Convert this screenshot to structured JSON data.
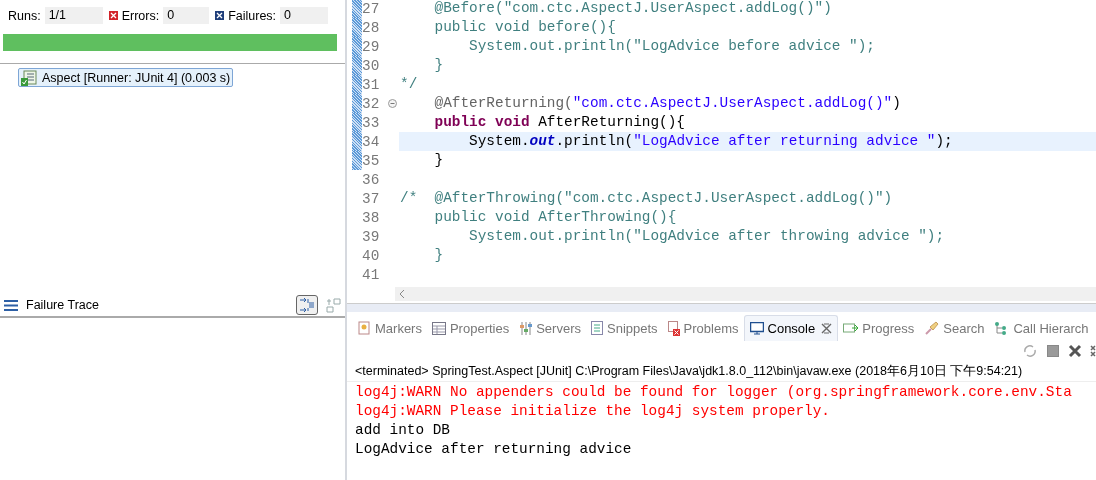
{
  "junit": {
    "counters": [
      {
        "kind": "runs",
        "label": "Runs:",
        "value": "1/1"
      },
      {
        "kind": "errors",
        "label": "Errors:",
        "value": "0"
      },
      {
        "kind": "failures",
        "label": "Failures:",
        "value": "0"
      }
    ],
    "progress": {
      "level": 1
    },
    "tree": [
      {
        "label": "Aspect [Runner: JUnit 4] (0.003 s)",
        "selected": true
      }
    ],
    "failure_trace": {
      "title": "Failure Trace",
      "toggle_pressed": true
    }
  },
  "editor": {
    "lines": [
      {
        "number": "27",
        "changed": true,
        "current": false,
        "segments": [
          {
            "kind": "comment",
            "text": "    @Before(\"com.ctc.AspectJ.UserAspect.addLog()\")"
          }
        ]
      },
      {
        "number": "28",
        "changed": true,
        "current": false,
        "segments": [
          {
            "kind": "comment",
            "text": "    public void before(){"
          }
        ]
      },
      {
        "number": "29",
        "changed": true,
        "current": false,
        "segments": [
          {
            "kind": "comment",
            "text": "        System.out.println(\"LogAdvice before advice \");"
          }
        ]
      },
      {
        "number": "30",
        "changed": true,
        "current": false,
        "segments": [
          {
            "kind": "comment",
            "text": "    }"
          }
        ]
      },
      {
        "number": "31",
        "changed": true,
        "current": false,
        "segments": [
          {
            "kind": "comment",
            "text": "*/"
          }
        ]
      },
      {
        "number": "32",
        "changed": true,
        "current": false,
        "fold_marker": true,
        "segments": [
          {
            "kind": "annotation",
            "text": "    @AfterReturning("
          },
          {
            "kind": "string",
            "text": "\"com.ctc.AspectJ.UserAspect.addLog()\""
          },
          {
            "kind": "plain",
            "text": ")"
          }
        ]
      },
      {
        "number": "33",
        "changed": true,
        "current": false,
        "segments": [
          {
            "kind": "keyword",
            "text": "    public"
          },
          {
            "kind": "keyword",
            "text": " void"
          },
          {
            "kind": "plain",
            "text": " AfterReturning(){"
          }
        ]
      },
      {
        "number": "34",
        "changed": true,
        "current": true,
        "segments": [
          {
            "kind": "plain",
            "text": "        System."
          },
          {
            "kind": "field",
            "text": "out"
          },
          {
            "kind": "plain",
            "text": ".println("
          },
          {
            "kind": "string",
            "text": "\"LogAdvice after returning advice \""
          },
          {
            "kind": "plain",
            "text": ");"
          }
        ]
      },
      {
        "number": "35",
        "changed": true,
        "current": false,
        "segments": [
          {
            "kind": "plain",
            "text": "    }"
          }
        ]
      },
      {
        "number": "36",
        "changed": false,
        "current": false
      },
      {
        "number": "37",
        "changed": false,
        "current": false,
        "segments": [
          {
            "kind": "comment",
            "text": "/*  @AfterThrowing(\"com.ctc.AspectJ.UserAspect.addLog()\")"
          }
        ]
      },
      {
        "number": "38",
        "changed": false,
        "current": false,
        "segments": [
          {
            "kind": "comment",
            "text": "    public void AfterThrowing(){"
          }
        ]
      },
      {
        "number": "39",
        "changed": false,
        "current": false,
        "segments": [
          {
            "kind": "comment",
            "text": "        System.out.println(\"LogAdvice after throwing advice \");"
          }
        ]
      },
      {
        "number": "40",
        "changed": false,
        "current": false,
        "segments": [
          {
            "kind": "comment",
            "text": "    }"
          }
        ]
      },
      {
        "number": "41",
        "changed": false,
        "current": false
      }
    ]
  },
  "bottom_tabs": [
    {
      "kind": "markers",
      "label": "Markers",
      "selected": false
    },
    {
      "kind": "properties",
      "label": "Properties",
      "selected": false
    },
    {
      "kind": "servers",
      "label": "Servers",
      "selected": false
    },
    {
      "kind": "snippets",
      "label": "Snippets",
      "selected": false
    },
    {
      "kind": "problems",
      "label": "Problems",
      "selected": false
    },
    {
      "kind": "console",
      "label": "Console",
      "selected": true
    },
    {
      "kind": "progress",
      "label": "Progress",
      "selected": false
    },
    {
      "kind": "search",
      "label": "Search",
      "selected": false
    },
    {
      "kind": "hierarchy",
      "label": "Call Hierarch",
      "selected": false
    }
  ],
  "console": {
    "header": "<terminated> SpringTest.Aspect [JUnit] C:\\Program Files\\Java\\jdk1.8.0_112\\bin\\javaw.exe (2018年6月10日 下午9:54:21)",
    "lines": [
      {
        "kind": "stderr",
        "text": "log4j:WARN No appenders could be found for logger (org.springframework.core.env.Sta"
      },
      {
        "kind": "stderr",
        "text": "log4j:WARN Please initialize the log4j system properly."
      },
      {
        "kind": "stdout",
        "text": "add into DB"
      },
      {
        "kind": "stdout",
        "text": "LogAdvice after returning advice"
      }
    ]
  }
}
